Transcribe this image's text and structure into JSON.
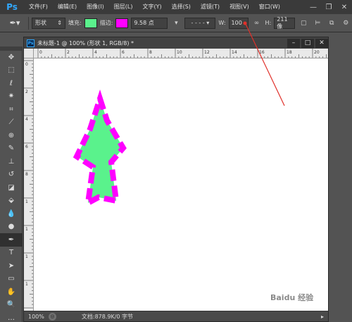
{
  "app": {
    "logo": "Ps"
  },
  "menu": {
    "items": [
      "文件(F)",
      "编辑(E)",
      "图像(I)",
      "图层(L)",
      "文字(Y)",
      "选择(S)",
      "滤镜(T)",
      "视图(V)",
      "窗口(W)"
    ]
  },
  "window_controls": [
    "—",
    "❐",
    "✕"
  ],
  "options": {
    "mode_value": "形状",
    "fill_label": "填充:",
    "fill_color": "#5af28c",
    "stroke_label": "描边:",
    "stroke_color": "#ff00ff",
    "stroke_width": "9.58 点",
    "w_label": "W:",
    "w_value": "100",
    "h_label": "H:",
    "h_value": "211 像"
  },
  "document": {
    "badge": "Ps",
    "title": "未标题-1 @ 100% (形状 1, RGB/8) *",
    "hruler_labels": [
      "0",
      "2",
      "4",
      "6",
      "8",
      "10",
      "12",
      "14",
      "16",
      "18",
      "20"
    ],
    "vruler_labels": [
      "0",
      "2",
      "4",
      "6",
      "8",
      "1",
      "1",
      "1",
      "1"
    ]
  },
  "status": {
    "zoom": "100%",
    "doc_info": "文档:878.9K/0 字节"
  },
  "shape": {
    "fill": "#5af28c",
    "stroke": "#ff00ff"
  },
  "annotation": {
    "color": "#e0302a"
  },
  "watermark": "Baidu 经验"
}
